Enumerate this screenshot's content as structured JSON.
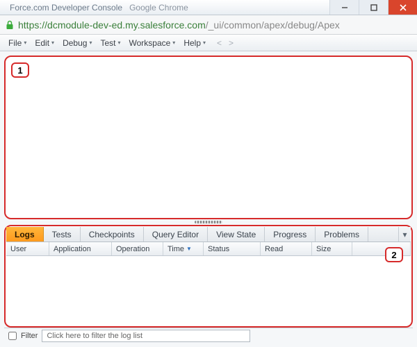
{
  "window": {
    "title_main": "Force.com Developer Console",
    "title_sub": "Google Chrome"
  },
  "url": {
    "scheme": "https://",
    "host": "dcmodule-dev-ed.my.salesforce.com",
    "path": "/_ui/common/apex/debug/Apex"
  },
  "menus": {
    "items": [
      "File",
      "Edit",
      "Debug",
      "Test",
      "Workspace",
      "Help"
    ],
    "nav_prev": "<",
    "nav_next": ">"
  },
  "annotations": {
    "top_label": "1",
    "bottom_label": "2"
  },
  "bottom_panel": {
    "tabs": [
      "Logs",
      "Tests",
      "Checkpoints",
      "Query Editor",
      "View State",
      "Progress",
      "Problems"
    ],
    "active_tab_index": 0,
    "columns": [
      "User",
      "Application",
      "Operation",
      "Time",
      "Status",
      "Read",
      "Size"
    ],
    "sorted_column_index": 3,
    "sort_direction": "desc"
  },
  "filter": {
    "checkbox_label": "Filter",
    "placeholder": "Click here to filter the log list"
  }
}
